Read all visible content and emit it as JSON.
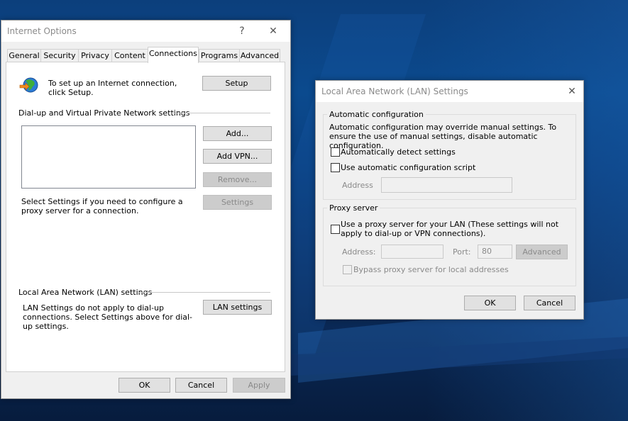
{
  "internet_options": {
    "title": "Internet Options",
    "help_glyph": "?",
    "close_glyph": "✕",
    "tabs": [
      "General",
      "Security",
      "Privacy",
      "Content",
      "Connections",
      "Programs",
      "Advanced"
    ],
    "active_tab": "Connections",
    "setup_text": "To set up an Internet connection, click Setup.",
    "setup_button": "Setup",
    "dialup_group": "Dial-up and Virtual Private Network settings",
    "add_button": "Add...",
    "add_vpn_button": "Add VPN...",
    "remove_button": "Remove...",
    "settings_text": "Select Settings if you need to configure a proxy server for a connection.",
    "settings_button": "Settings",
    "lan_group": "Local Area Network (LAN) settings",
    "lan_text": "LAN Settings do not apply to dial-up connections. Select Settings above for dial-up settings.",
    "lan_settings_button": "LAN settings",
    "ok_button": "OK",
    "cancel_button": "Cancel",
    "apply_button": "Apply"
  },
  "lan_dialog": {
    "title": "Local Area Network (LAN) Settings",
    "close_glyph": "✕",
    "auto_group": "Automatic configuration",
    "auto_text": "Automatic configuration may override manual settings.  To ensure the use of manual settings, disable automatic configuration.",
    "auto_detect_label": "Automatically detect settings",
    "auto_detect_checked": false,
    "auto_script_label": "Use automatic configuration script",
    "auto_script_checked": false,
    "address_label": "Address",
    "address_value": "",
    "proxy_group": "Proxy server",
    "use_proxy_label": "Use a proxy server for your LAN (These settings will not apply to dial-up or VPN connections).",
    "use_proxy_checked": false,
    "proxy_address_label": "Address:",
    "proxy_address_value": "",
    "port_label": "Port:",
    "port_value": "80",
    "advanced_button": "Advanced",
    "bypass_label": "Bypass proxy server for local addresses",
    "bypass_checked": false,
    "ok_button": "OK",
    "cancel_button": "Cancel"
  }
}
